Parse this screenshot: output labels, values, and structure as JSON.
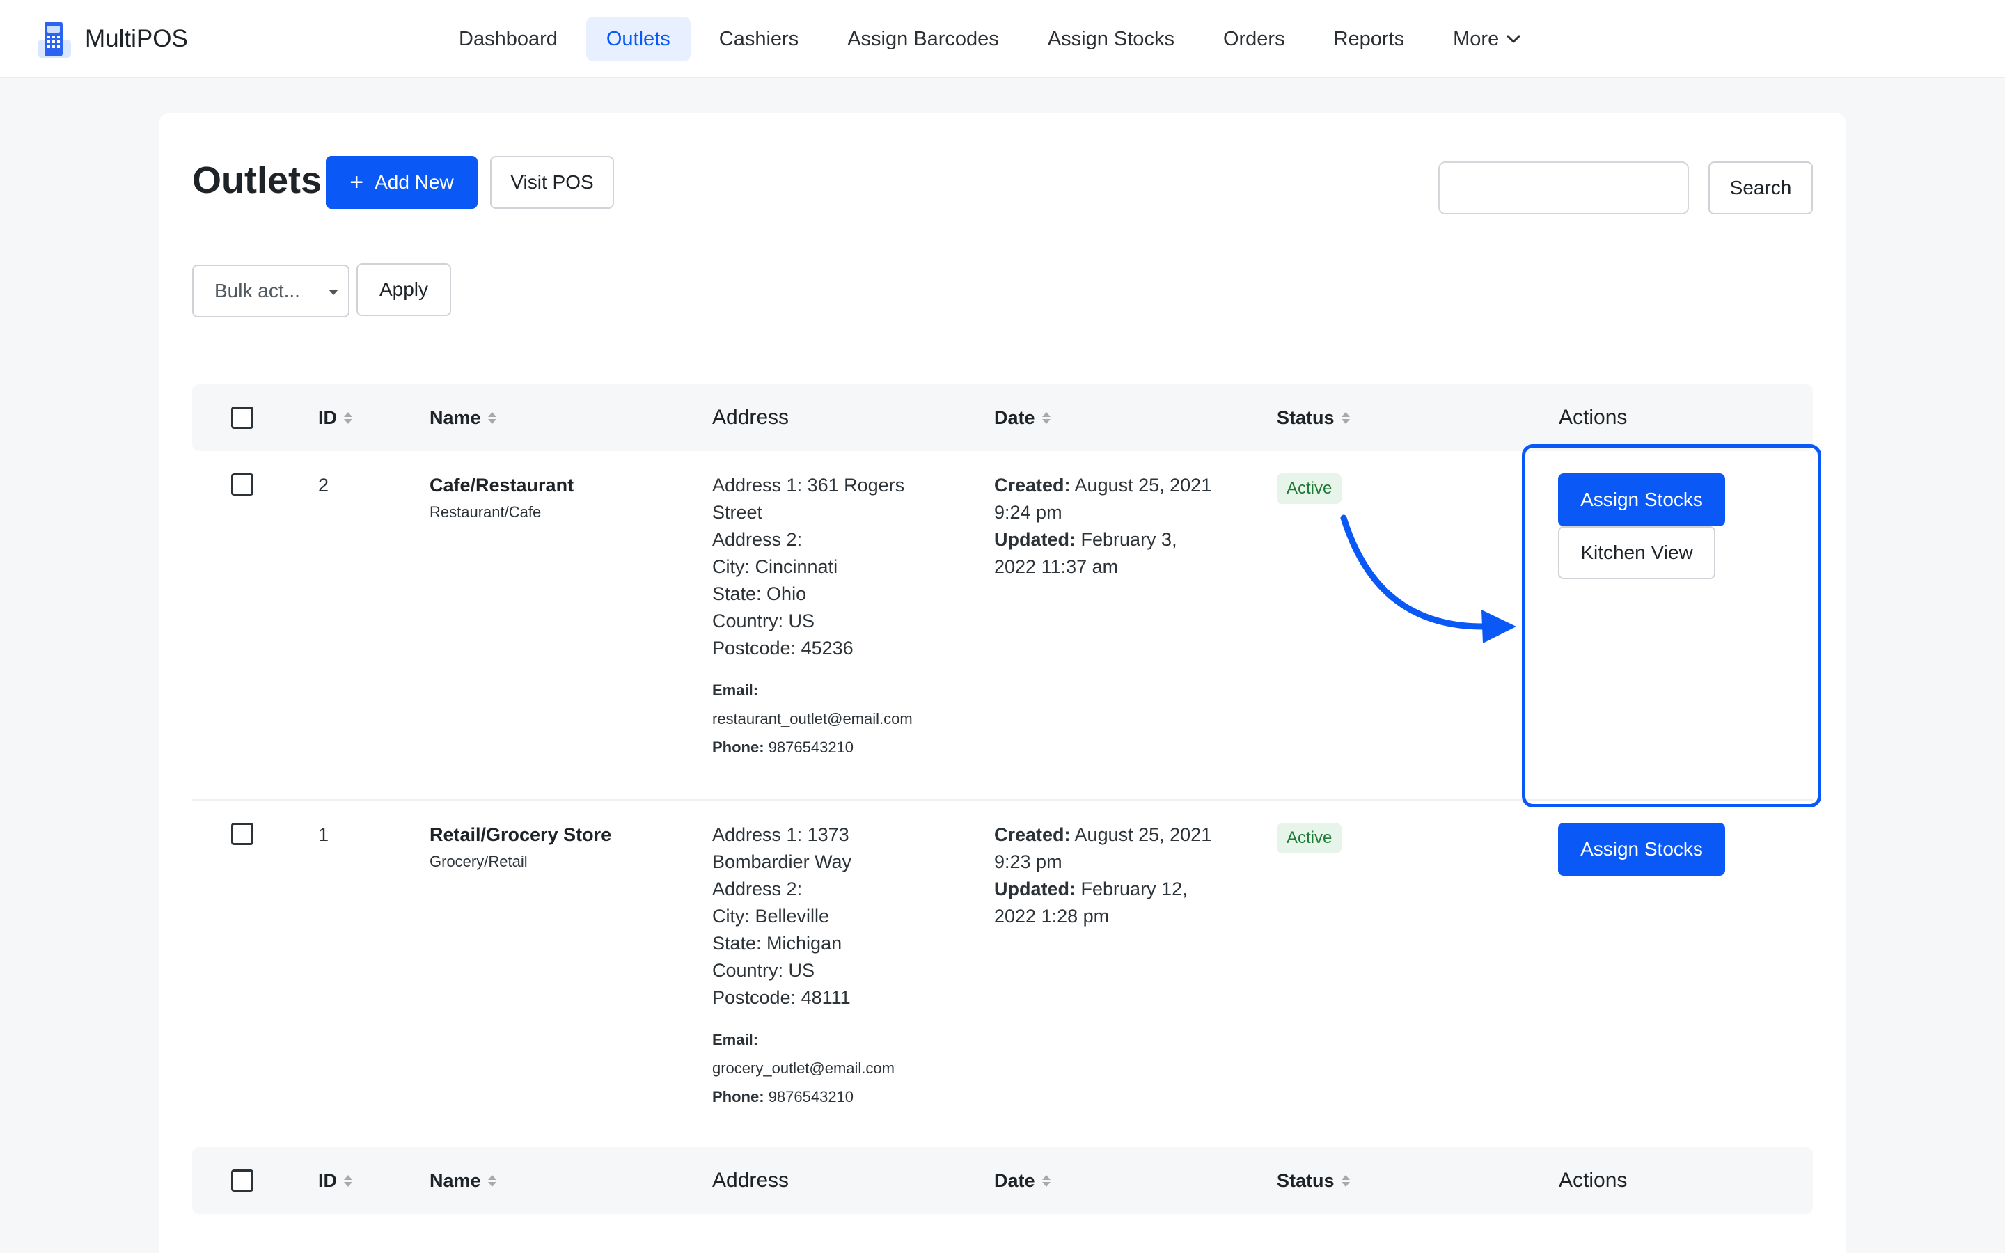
{
  "app": {
    "name": "MultiPOS"
  },
  "nav": {
    "items": [
      "Dashboard",
      "Outlets",
      "Cashiers",
      "Assign Barcodes",
      "Assign Stocks",
      "Orders",
      "Reports"
    ],
    "more_label": "More",
    "active": "Outlets"
  },
  "page": {
    "title": "Outlets",
    "add_new_label": "Add New",
    "visit_pos_label": "Visit POS",
    "search_label": "Search",
    "search_value": ""
  },
  "bulk": {
    "placeholder": "Bulk act...",
    "apply_label": "Apply"
  },
  "table": {
    "columns": {
      "id": "ID",
      "name": "Name",
      "address": "Address",
      "date": "Date",
      "status": "Status",
      "actions": "Actions"
    },
    "rows": [
      {
        "id": "2",
        "name": "Cafe/Restaurant",
        "type": "Restaurant/Cafe",
        "address_lines": [
          "Address 1: 361 Rogers",
          "Street",
          "Address 2:",
          "City: Cincinnati",
          "State: Ohio",
          "Country: US",
          "Postcode: 45236"
        ],
        "email_label": "Email:",
        "email": "restaurant_outlet@email.com",
        "phone_label": "Phone:",
        "phone": "9876543210",
        "created_label": "Created:",
        "created_a": "August 25, 2021",
        "created_b": "9:24 pm",
        "updated_label": "Updated:",
        "updated_a": "February 3,",
        "updated_b": "2022 11:37 am",
        "status": "Active",
        "actions": [
          "Assign Stocks",
          "Kitchen View"
        ]
      },
      {
        "id": "1",
        "name": "Retail/Grocery Store",
        "type": "Grocery/Retail",
        "address_lines": [
          "Address 1: 1373",
          "Bombardier Way",
          "Address 2:",
          "City: Belleville",
          "State: Michigan",
          "Country: US",
          "Postcode: 48111"
        ],
        "email_label": "Email:",
        "email": "grocery_outlet@email.com",
        "phone_label": "Phone:",
        "phone": "9876543210",
        "created_label": "Created:",
        "created_a": "August 25, 2021",
        "created_b": "9:23 pm",
        "updated_label": "Updated:",
        "updated_a": "February 12,",
        "updated_b": "2022 1:28 pm",
        "status": "Active",
        "actions": [
          "Assign Stocks"
        ]
      }
    ]
  },
  "colors": {
    "accent": "#0a58f5",
    "active_badge_bg": "#e6f4ea",
    "active_badge_text": "#1e7a34"
  },
  "icons": [
    "multipos-logo-icon",
    "chevron-down-icon",
    "plus-icon",
    "sort-icon",
    "caret-down-icon",
    "curved-arrow-icon"
  ]
}
